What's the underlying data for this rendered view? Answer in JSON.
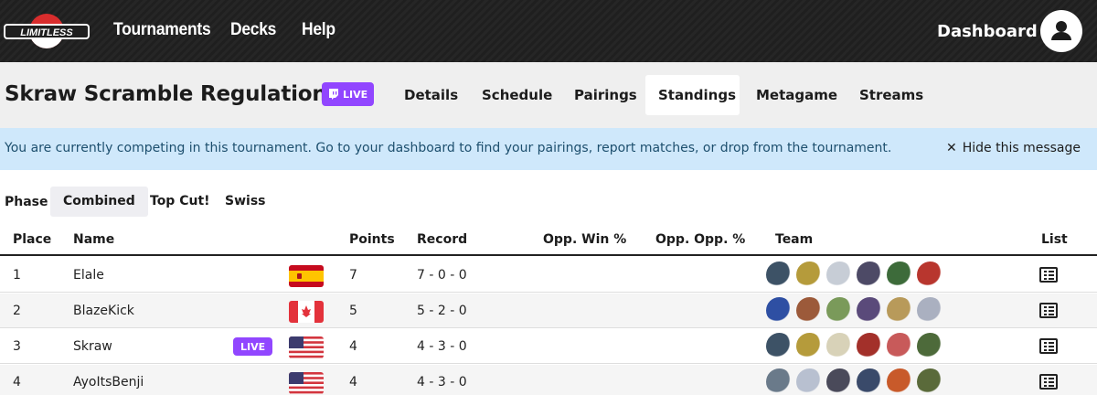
{
  "nav": {
    "logo_text": "LIMITLESS",
    "links": [
      "Tournaments",
      "Decks",
      "Help"
    ],
    "dashboard": "Dashboard",
    "avatar_icon": "user-icon"
  },
  "tournament": {
    "title": "Skraw Scramble Regulation I!",
    "live_label": "LIVE",
    "tabs": [
      {
        "label": "Details"
      },
      {
        "label": "Schedule"
      },
      {
        "label": "Pairings"
      },
      {
        "label": "Standings",
        "active": true
      },
      {
        "label": "Metagame"
      },
      {
        "label": "Streams"
      }
    ]
  },
  "alert": {
    "message": "You are currently competing in this tournament. Go to your dashboard to find your pairings, report matches, or drop from the tournament.",
    "hide_label": "Hide this message"
  },
  "phase": {
    "label": "Phase",
    "options": [
      {
        "label": "Combined",
        "active": true
      },
      {
        "label": "Top Cut!"
      },
      {
        "label": "Swiss"
      }
    ]
  },
  "table": {
    "headers": {
      "place": "Place",
      "name": "Name",
      "points": "Points",
      "record": "Record",
      "opp_win": "Opp. Win %",
      "opp_opp": "Opp. Opp. %",
      "team": "Team",
      "list": "List"
    },
    "rows": [
      {
        "place": "1",
        "name": "Elale",
        "flag": "ES",
        "live": "",
        "points": "7",
        "record": "7 - 0 - 0",
        "team_colors": [
          "#3d5266",
          "#b59b3b",
          "#c7cdd6",
          "#4d4a66",
          "#3d6b3a",
          "#b8362e"
        ]
      },
      {
        "place": "2",
        "name": "BlazeKick",
        "flag": "CA",
        "live": "",
        "points": "5",
        "record": "5 - 2 - 0",
        "team_colors": [
          "#2e4fa3",
          "#9c5a3a",
          "#7a9a5a",
          "#5a4a7a",
          "#b89a5a",
          "#aab0c0"
        ]
      },
      {
        "place": "3",
        "name": "Skraw",
        "flag": "US",
        "live": "LIVE",
        "points": "4",
        "record": "4 - 3 - 0",
        "team_colors": [
          "#3d5266",
          "#b59b3b",
          "#d8d2b8",
          "#a3302a",
          "#c85a5a",
          "#4d6a3a"
        ]
      },
      {
        "place": "4",
        "name": "AyoItsBenji",
        "flag": "US",
        "live": "",
        "points": "4",
        "record": "4 - 3 - 0",
        "team_colors": [
          "#6a7a8a",
          "#b8c0d0",
          "#4a4a5a",
          "#3a4a6a",
          "#c85a2a",
          "#5a6a3a"
        ]
      }
    ]
  },
  "colors": {
    "nav_bg": "#222222",
    "live_purple": "#9146ff",
    "alert_bg": "#cfe8fb",
    "alert_text": "#1d4f6e"
  }
}
